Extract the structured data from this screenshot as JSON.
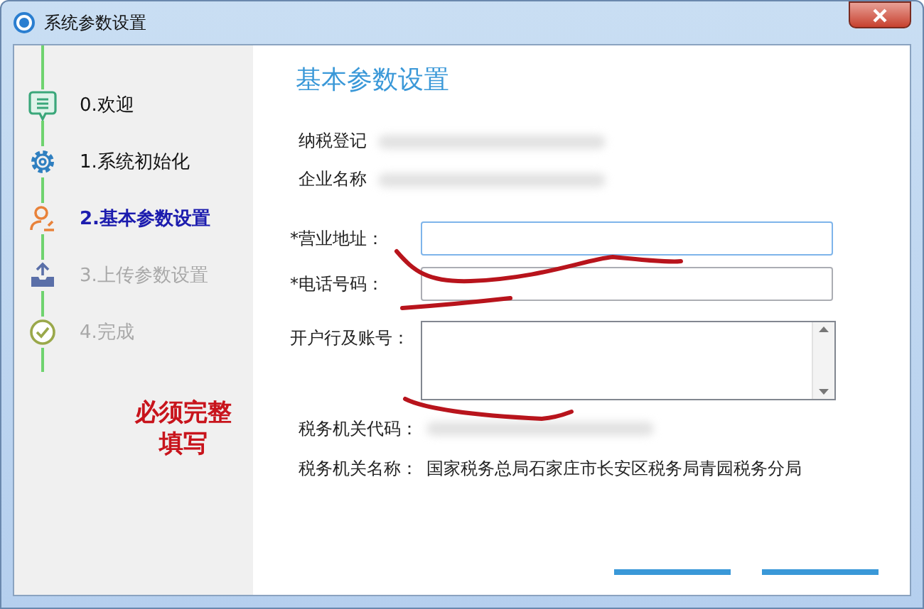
{
  "window": {
    "title": "系统参数设置"
  },
  "steps": [
    {
      "label": "0.欢迎",
      "kind": "welcome",
      "selected": false,
      "disabled": false
    },
    {
      "label": "1.系统初始化",
      "kind": "init",
      "selected": false,
      "disabled": false
    },
    {
      "label": "2.基本参数设置",
      "kind": "params",
      "selected": true,
      "disabled": false
    },
    {
      "label": "3.上传参数设置",
      "kind": "upload",
      "selected": false,
      "disabled": true
    },
    {
      "label": "4.完成",
      "kind": "done",
      "selected": false,
      "disabled": true
    }
  ],
  "annotation": {
    "lines": [
      "必须完整",
      "填写"
    ]
  },
  "form": {
    "heading": "基本参数设置",
    "info_top": [
      {
        "label": "纳税登记"
      },
      {
        "label": "企业名称"
      }
    ],
    "fields": [
      {
        "label": "*营业地址：",
        "kind": "input"
      },
      {
        "label": "*电话号码：",
        "kind": "input"
      },
      {
        "label": "开户行及账号：",
        "kind": "textarea"
      }
    ],
    "info_bottom": [
      {
        "label": "税务机关代码："
      },
      {
        "label": "税务机关名称：",
        "value": "国家税务总局石家庄市长安区税务局青园税务分局"
      }
    ]
  }
}
